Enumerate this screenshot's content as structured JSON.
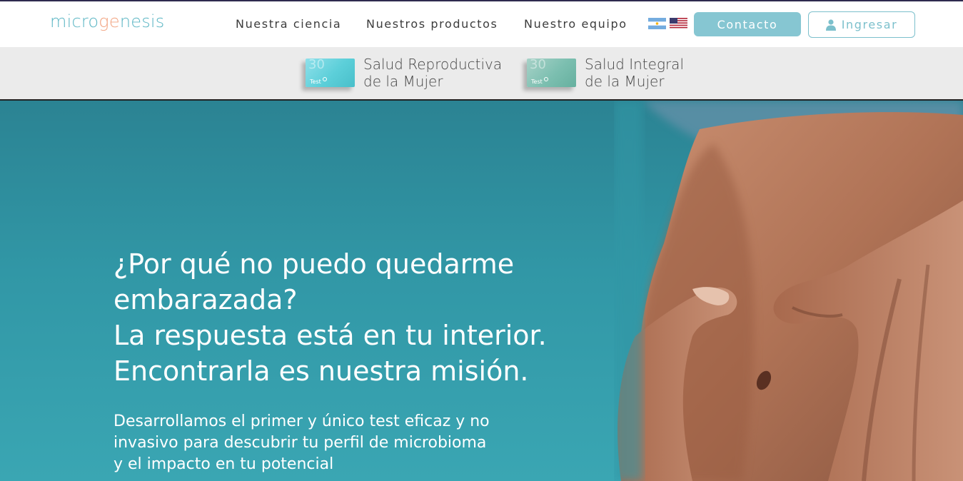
{
  "logo": {
    "part1": "micro",
    "part2": "ge",
    "part3": "nesis"
  },
  "nav": {
    "links": [
      "Nuestra ciencia",
      "Nuestros productos",
      "Nuestro equipo"
    ],
    "contact_label": "Contacto",
    "login_label": "Ingresar",
    "accent_color": "#86c6d2"
  },
  "products": [
    {
      "line1": "Salud Reproductiva",
      "line2": "de la Mujer",
      "package_mark": "Test"
    },
    {
      "line1": "Salud Integral",
      "line2": "de la Mujer",
      "package_mark": "Test"
    }
  ],
  "hero": {
    "heading": [
      "¿Por qué no puedo quedarme",
      "embarazada?",
      "La respuesta está en tu interior.",
      "Encontrarla es nuestra misión."
    ],
    "body": "Desarrollamos el primer y único test eficaz y no invasivo para descubrir tu perfil de microbioma y el impacto en tu potencial",
    "background_color": "#3197a6"
  }
}
